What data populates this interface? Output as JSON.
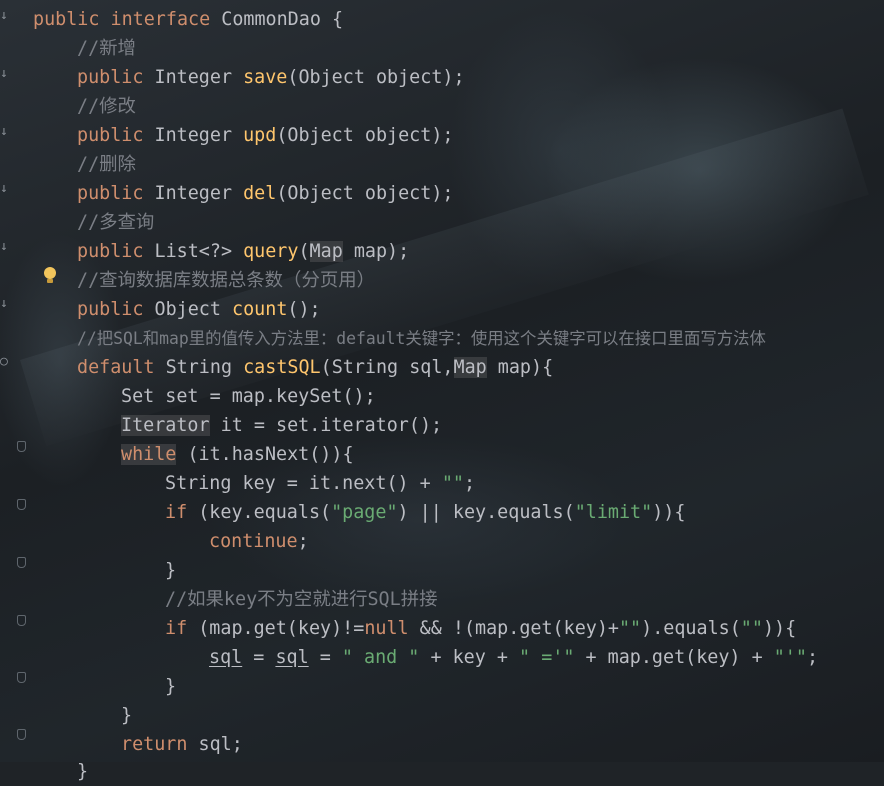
{
  "colors": {
    "keyword": "#cf8e6d",
    "function": "#ffc66d",
    "string": "#6aab73",
    "comment": "#7a7e85",
    "text": "#bcbec4"
  },
  "gutter_icons": [
    "implementation-arrow-icon",
    "fold-icon",
    "intention-bulb-icon"
  ],
  "code": {
    "l01": [
      "public",
      "interface",
      "CommonDao {"
    ],
    "l02": "//新增",
    "l03": [
      "public",
      "Integer ",
      "save",
      "(Object object);"
    ],
    "l04": "//修改",
    "l05": [
      "public",
      "Integer ",
      "upd",
      "(Object object);"
    ],
    "l06": "//删除",
    "l07": [
      "public",
      "Integer ",
      "del",
      "(Object object);"
    ],
    "l08": "//多查询",
    "l09": [
      "public",
      "List<?> ",
      "query",
      "(",
      "Map",
      " map);"
    ],
    "l10": "//查询数据库数据总条数（分页用）",
    "l11": [
      "public",
      "Object ",
      "count",
      "();"
    ],
    "l12": "//把SQL和map里的值传入方法里：default关键字：使用这个关键字可以在接口里面写方法体",
    "l13": [
      "default",
      "String ",
      "castSQL",
      "(String sql,",
      "Map",
      " map){"
    ],
    "l14": "Set set = map.keySet();",
    "l15": [
      "Iterator",
      " it = set.iterator();"
    ],
    "l16": [
      "while",
      " (it.hasNext()){"
    ],
    "l17": [
      "String key = it.next() + ",
      "\"\"",
      ";"
    ],
    "l18": [
      "if",
      " (key.equals(",
      "\"page\"",
      ") || key.equals(",
      "\"limit\"",
      ")){"
    ],
    "l19": [
      "continue",
      ";"
    ],
    "l20": "}",
    "l21": "//如果key不为空就进行SQL拼接",
    "l22": [
      "if",
      " (map.get(key)!=",
      "null",
      " && !(map.get(key)+",
      "\"\"",
      ").equals(",
      "\"\"",
      ")){"
    ],
    "l23": [
      "sql",
      " = ",
      "sql",
      " = ",
      "\" and \"",
      " + key + ",
      "\" ='\"",
      " + map.get(key) + ",
      "\"'\"",
      ";"
    ],
    "l24": "}",
    "l25": "}",
    "l26": [
      "return",
      " sql;"
    ],
    "l27": "}"
  }
}
